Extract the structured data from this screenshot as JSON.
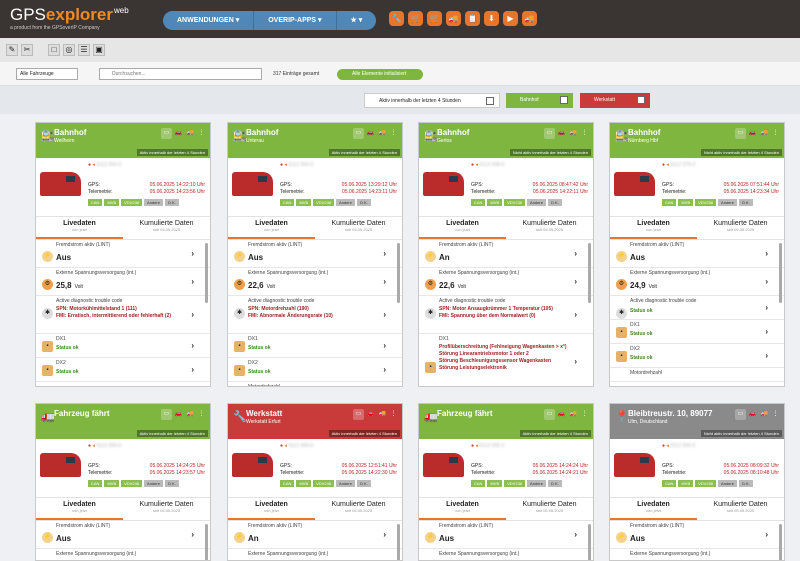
{
  "header": {
    "logo_main": "GPS",
    "logo_accent": "explorer",
    "logo_sup": "web",
    "logo_sub": "a product from the GPSoverIP Company",
    "nav": [
      {
        "label": "ANWENDUNGEN ▾"
      },
      {
        "label": "OVERIP-APPS ▾"
      },
      {
        "label": "★ ▾"
      }
    ],
    "tools": [
      {
        "icon": "🔧"
      },
      {
        "icon": "🛒"
      },
      {
        "icon": "🛒"
      },
      {
        "icon": "🚚"
      },
      {
        "icon": "📋"
      },
      {
        "icon": "⬇"
      },
      {
        "icon": "▶"
      },
      {
        "icon": "🚚"
      }
    ]
  },
  "filters": {
    "vehicle_select": "Alle Fahrzeuge",
    "search_placeholder": "Durchsuchen...",
    "count": "317 Einträge gesamt",
    "init_badge": "Alle Elemente initialisiert",
    "active_toggle": "Aktiv innerhalb der letzten 4 Stunden",
    "bahnhof_toggle": "Bahnhof",
    "werkstatt_toggle": "Werkstatt"
  },
  "common": {
    "gps_label": "GPS:",
    "tele_label": "Telemetrie:",
    "chips": [
      "CAN",
      "MVB",
      "VDV238",
      "Andere",
      "D.K."
    ],
    "tab_live": "Livedaten",
    "tab_live_sub": "von jetzt",
    "tab_cum": "Kumulierte Daten",
    "tab_cum_sub": "seit 05.05.2025",
    "row_brake": "Fremdstrom aktiv (LINT)",
    "row_volt": "Externe Spannungsversorgung (int.)",
    "row_dtc": "Active diagnostic trouble code",
    "unit_volt": "Volt",
    "status_ok": "Status ok",
    "label_dx1": "DX1",
    "label_dx2": "DX2",
    "label_motor": "Motordrehzahl"
  },
  "vehicles": [
    {
      "title": "Bahnhof",
      "subtitle": "Weilheim",
      "status": "Aktiv innerhalb der letzten 4 Stunden",
      "id": "6113 000-0",
      "gps": "05.06.2025 14:22:10 Uhr",
      "tele": "05.06.2025 14:23:56 Uhr",
      "brake": "Aus",
      "volt": "25,8",
      "dtc1": "SPN: Motorkühlmittelstand 1 (111)",
      "dtc2": "FMI: Erratisch, intermittierend oder fehlerhaft (2)",
      "dx1": "Status ok",
      "dx2": "Status ok"
    },
    {
      "title": "Bahnhof",
      "subtitle": "Unterau",
      "status": "Aktiv innerhalb der letzten 4 Stunden",
      "id": "6112 000-0",
      "gps": "05.06.2025 13:29:12 Uhr",
      "tele": "05.06.2025 14:23:11 Uhr",
      "brake": "Aus",
      "volt": "22,6",
      "dtc1": "SPN: Motordrehzahl (190)",
      "dtc2": "FMI: Abnormale Änderungsrate (10)",
      "dx1": "Status ok",
      "dx2": "Status ok",
      "motor": "Motordrehzahl"
    },
    {
      "title": "Bahnhof",
      "subtitle": "Gerlos",
      "status": "Nicht aktiv innerhalb der letzten 4 Stunden",
      "id": "6113 008-0",
      "gps": "05.06.2025 08:47:42 Uhr",
      "tele": "05.06.2025 14:22:11 Uhr",
      "brake": "An",
      "volt": "22,6",
      "dtc1": "SPN: Motor Ansaugkrümmer 1 Temperatur (105)",
      "dtc2": "FMI: Spannung über dem Normalwert (0)",
      "dx1": "DX1",
      "dx1_err": "Profilüberschreitung (Fehlneigung Wagenkasten > x°)",
      "dx1_err2": "Störung Linearantriebsmotor 1 oder 2",
      "dx1_err3": "Störung Beschleunigungssensor Wagenkasten",
      "dx1_err4": "Störung Leistungselektronik"
    },
    {
      "title": "Bahnhof",
      "subtitle": "Nürnberg Hbf",
      "status": "Nicht aktiv innerhalb der letzten 4 Stunden",
      "id": "6112 079-0",
      "gps": "05.06.2025 07:51:44 Uhr",
      "tele": "05.06.2025 14:23:34 Uhr",
      "brake": "Aus",
      "volt": "24,9",
      "dtc1": "Status ok",
      "dx1": "Status ok",
      "dx2": "Status ok",
      "motor": "Motordrehzahl"
    },
    {
      "title": "Fahrzeug fährt",
      "subtitle": "",
      "status": "Aktiv innerhalb der letzten 4 Stunden",
      "id": "6113 000-0",
      "gps": "05.06.2025 14:24:25 Uhr",
      "tele": "05.06.2025 14:23:57 Uhr",
      "brake": "Aus"
    },
    {
      "title": "Werkstatt",
      "subtitle": "Werkstatt Erfurt",
      "status": "Aktiv innerhalb der letzten 4 Stunden",
      "id": "6112 000-0",
      "gps": "05.06.2025 12:51:41 Uhr",
      "tele": "05.06.2025 14:22:30 Uhr",
      "brake": "An"
    },
    {
      "title": "Fahrzeug fährt",
      "subtitle": "",
      "status": "Aktiv innerhalb der letzten 4 Stunden",
      "id": "6113 000-0",
      "gps": "05.06.2025 14:24:24 Uhr",
      "tele": "05.06.2025 14:24:21 Uhr",
      "brake": "Aus"
    },
    {
      "title": "Bleibtreustr. 10, 89077",
      "subtitle": "Ulm, Deutschland",
      "status": "Nicht aktiv innerhalb der letzten 4 Stunden",
      "id": "6112 000-0",
      "gps": "05.06.2025 08:09:32 Uhr",
      "tele": "05.06.2025 08:10:48 Uhr",
      "brake": "Aus"
    }
  ]
}
